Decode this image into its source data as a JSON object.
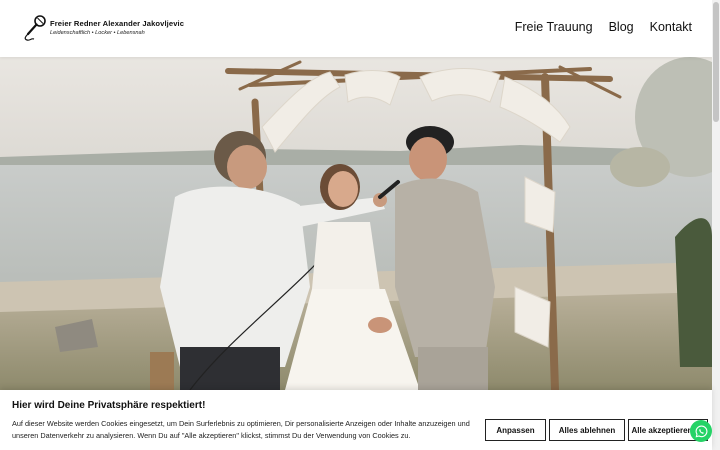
{
  "header": {
    "logo_name": "Freier Redner Alexander Jakovljevic",
    "logo_tagline": "Leidenschaftlich • Locker • Lebensnah",
    "logo_icon": "microphone-icon",
    "nav": [
      {
        "label": "Freie Trauung"
      },
      {
        "label": "Blog"
      },
      {
        "label": "Kontakt"
      }
    ]
  },
  "hero": {
    "image": "wedding-ceremony-photo"
  },
  "cookie_banner": {
    "title": "Hier wird Deine Privatsphäre respektiert!",
    "text": "Auf dieser Website werden Cookies eingesetzt, um Dein Surferlebnis zu optimieren, Dir personalisierte Anzeigen oder Inhalte anzuzeigen und unseren Datenverkehr zu analysieren. Wenn Du auf \"Alle akzeptieren\" klickst, stimmst Du der Verwendung von Cookies zu.",
    "buttons": {
      "adjust": "Anpassen",
      "reject": "Alles ablehnen",
      "accept": "Alle akzeptieren"
    }
  },
  "whatsapp": {
    "icon": "whatsapp-icon",
    "color": "#25d366"
  }
}
